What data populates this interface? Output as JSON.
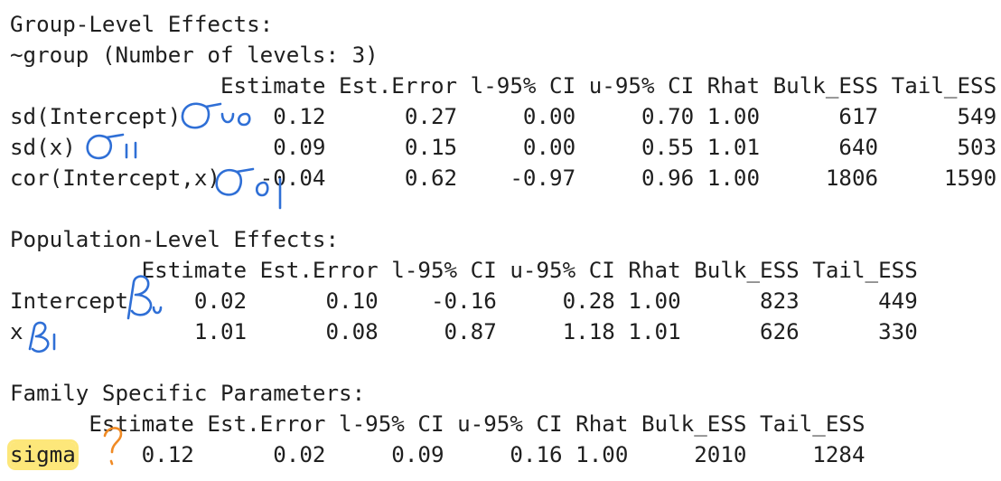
{
  "group_section": {
    "title": "Group-Level Effects:",
    "subtitle": "~group (Number of levels: 3)",
    "header": "                Estimate Est.Error l-95% CI u-95% CI Rhat Bulk_ESS Tail_ESS",
    "rows": [
      "sd(Intercept)       0.12      0.27     0.00     0.70 1.00      617      549",
      "sd(x)               0.09      0.15     0.00     0.55 1.01      640      503",
      "cor(Intercept,x)   -0.04      0.62    -0.97     0.96 1.00     1806     1590"
    ]
  },
  "population_section": {
    "title": "Population-Level Effects:",
    "header": "          Estimate Est.Error l-95% CI u-95% CI Rhat Bulk_ESS Tail_ESS",
    "rows": [
      "Intercept     0.02      0.10    -0.16     0.28 1.00      823      449",
      "x             1.01      0.08     0.87     1.18 1.01      626      330"
    ]
  },
  "family_section": {
    "title": "Family Specific Parameters:",
    "header": "      Estimate Est.Error l-95% CI u-95% CI Rhat Bulk_ESS Tail_ESS",
    "row_label": "sigma",
    "row_values": "     0.12      0.02     0.09     0.16 1.00     2010     1284"
  },
  "annotations": {
    "ink_color": "#2f6fd6",
    "highlight_color": "#fde77a",
    "question_color": "#f08a24",
    "marks": [
      "sigma-00-handwritten",
      "sigma-11-handwritten",
      "sigma-01-handwritten",
      "beta-0-handwritten",
      "beta-1-handwritten",
      "question-mark-handwritten"
    ]
  }
}
